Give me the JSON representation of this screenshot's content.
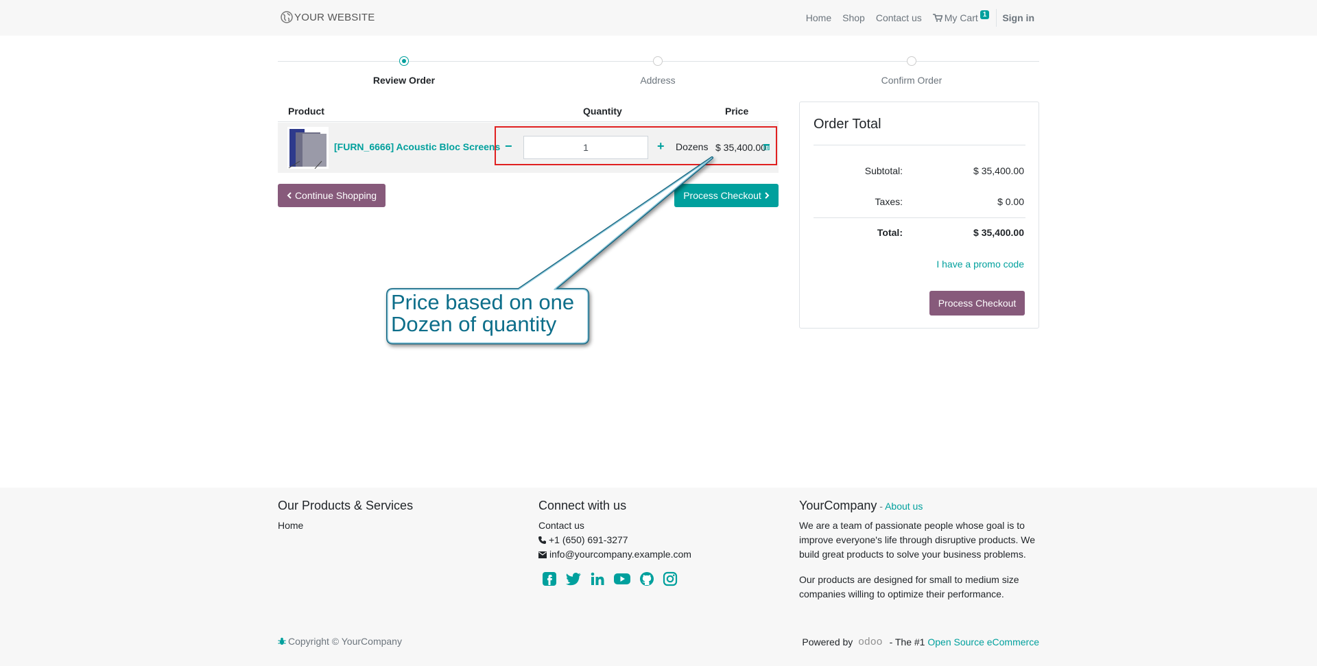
{
  "header": {
    "brand": "YOUR WEBSITE",
    "nav": [
      "Home",
      "Shop",
      "Contact us"
    ],
    "cart_label": "My Cart",
    "cart_count": "1",
    "signin": "Sign in"
  },
  "steps": [
    {
      "label": "Review Order",
      "active": true
    },
    {
      "label": "Address",
      "active": false
    },
    {
      "label": "Confirm Order",
      "active": false
    }
  ],
  "cart": {
    "headers": {
      "product": "Product",
      "quantity": "Quantity",
      "price": "Price"
    },
    "line": {
      "product": "[FURN_6666] Acoustic Bloc Screens",
      "quantity": "1",
      "uom": "Dozens",
      "price": "$ 35,400.00"
    },
    "continue_label": "Continue Shopping",
    "checkout_label": "Process Checkout"
  },
  "order_total": {
    "title": "Order Total",
    "subtotal_label": "Subtotal:",
    "subtotal_value": "$ 35,400.00",
    "taxes_label": "Taxes:",
    "taxes_value": "$ 0.00",
    "total_label": "Total:",
    "total_value": "$ 35,400.00",
    "promo": "I have a promo code",
    "checkout_label": "Process Checkout"
  },
  "callout": {
    "line1": "Price based on one",
    "line2": "Dozen of quantity"
  },
  "footer": {
    "col1_title": "Our Products & Services",
    "col1_link": "Home",
    "col2_title": "Connect with us",
    "col2_contact": "Contact us",
    "phone": "+1 (650) 691-3277",
    "email": "info@yourcompany.example.com",
    "col3_title": "YourCompany",
    "col3_sep": " - ",
    "col3_link": "About us",
    "about_p1": "We are a team of passionate people whose goal is to improve everyone's life through disruptive products. We build great products to solve your business problems.",
    "about_p2": "Our products are designed for small to medium size companies willing to optimize their performance.",
    "copyright": "Copyright © YourCompany",
    "powered_by": "Powered by",
    "powered_logo": "odoo",
    "powered_mid": " - The #1 ",
    "powered_link": "Open Source eCommerce"
  },
  "colors": {
    "accent": "#00A09D",
    "primary": "#875A7B",
    "callout": "#0d6e8a",
    "highlight": "#e02020"
  }
}
